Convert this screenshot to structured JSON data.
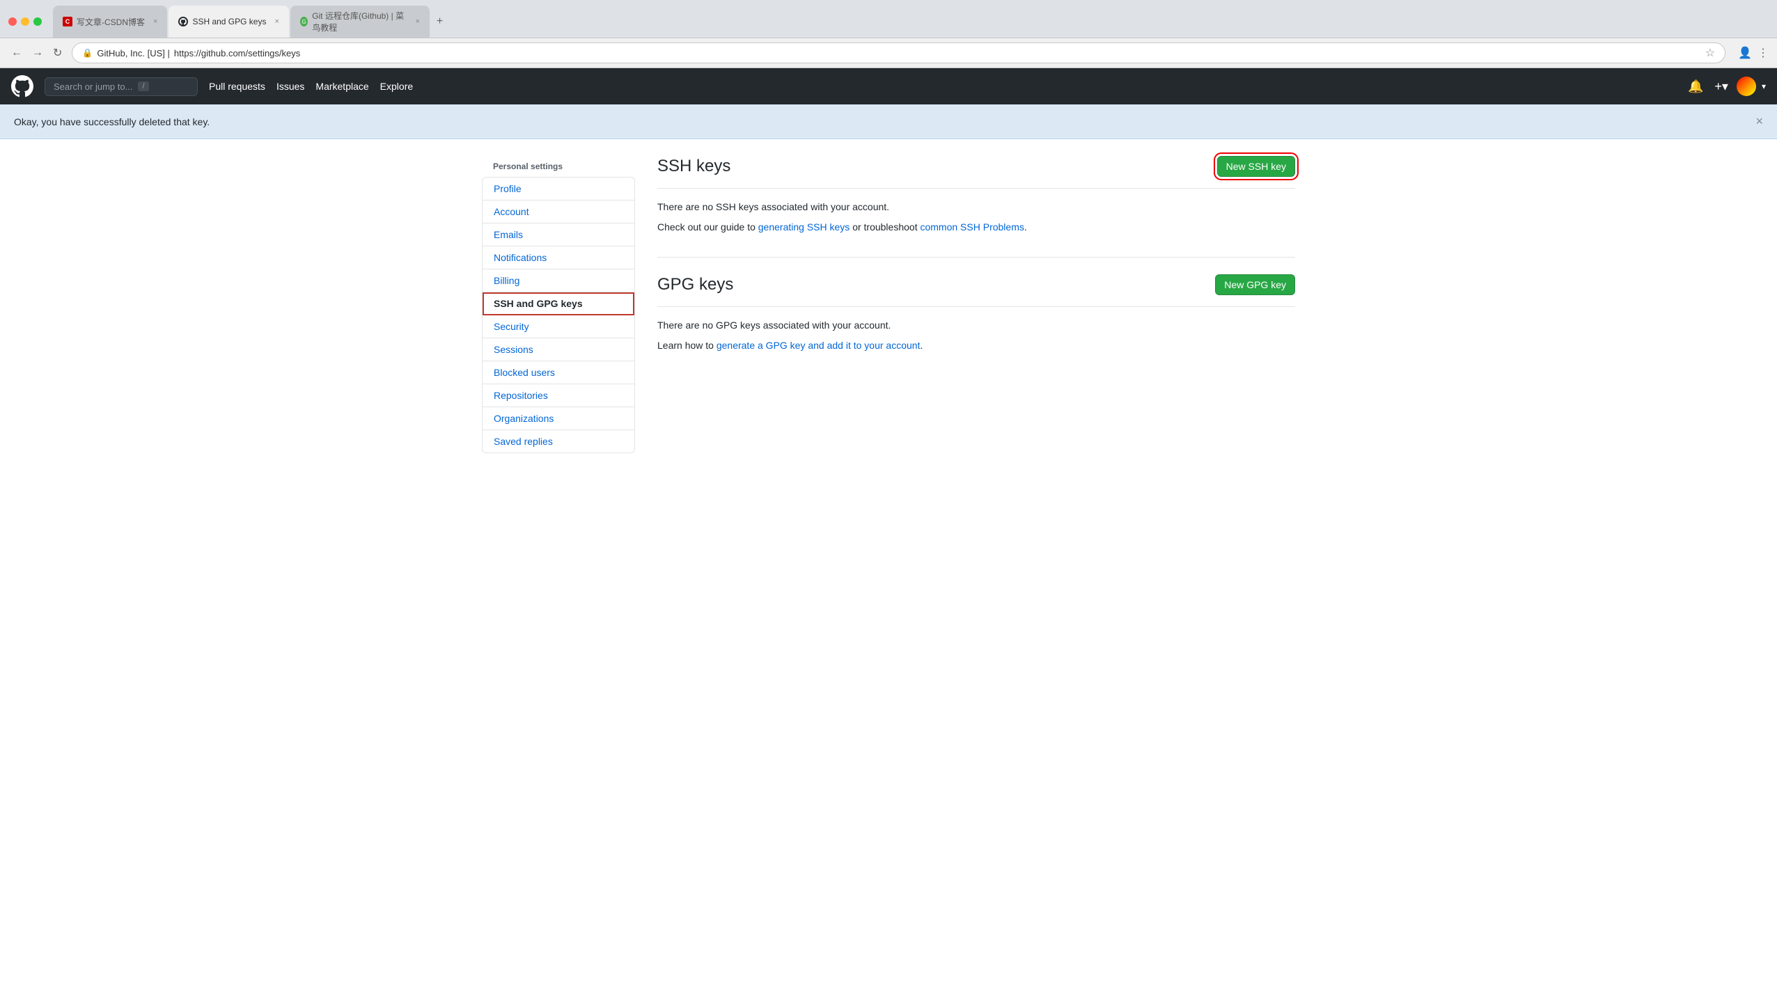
{
  "browser": {
    "tabs": [
      {
        "id": "csdn",
        "label": "写文章-CSDN博客",
        "favicon_type": "csdn",
        "active": false
      },
      {
        "id": "github",
        "label": "SSH and GPG keys",
        "favicon_type": "github",
        "active": true
      },
      {
        "id": "git",
        "label": "Git 远程仓库(Github) | 菜鸟教程",
        "favicon_type": "git",
        "active": false
      }
    ],
    "address": "https://github.com/settings/keys",
    "address_prefix": "GitHub, Inc. [US] | "
  },
  "nav": {
    "search_placeholder": "Search or jump to...",
    "links": [
      "Pull requests",
      "Issues",
      "Marketplace",
      "Explore"
    ]
  },
  "flash": {
    "message": "Okay, you have successfully deleted that key."
  },
  "sidebar": {
    "heading": "Personal settings",
    "items": [
      {
        "id": "profile",
        "label": "Profile",
        "active": false
      },
      {
        "id": "account",
        "label": "Account",
        "active": false
      },
      {
        "id": "emails",
        "label": "Emails",
        "active": false
      },
      {
        "id": "notifications",
        "label": "Notifications",
        "active": false
      },
      {
        "id": "billing",
        "label": "Billing",
        "active": false
      },
      {
        "id": "ssh-gpg",
        "label": "SSH and GPG keys",
        "active": true,
        "highlighted": true
      },
      {
        "id": "security",
        "label": "Security",
        "active": false
      },
      {
        "id": "sessions",
        "label": "Sessions",
        "active": false
      },
      {
        "id": "blocked-users",
        "label": "Blocked users",
        "active": false
      },
      {
        "id": "repositories",
        "label": "Repositories",
        "active": false
      },
      {
        "id": "organizations",
        "label": "Organizations",
        "active": false
      },
      {
        "id": "saved-replies",
        "label": "Saved replies",
        "active": false
      }
    ]
  },
  "main": {
    "ssh_section": {
      "title": "SSH keys",
      "new_button": "New SSH key",
      "empty_message": "There are no SSH keys associated with your account.",
      "guide_text": "Check out our guide to",
      "guide_link1": "generating SSH keys",
      "or_text": "or troubleshoot",
      "guide_link2": "common SSH Problems",
      "guide_link1_url": "#",
      "guide_link2_url": "#"
    },
    "gpg_section": {
      "title": "GPG keys",
      "new_button": "New GPG key",
      "empty_message": "There are no GPG keys associated with your account.",
      "learn_text": "Learn how to",
      "learn_link": "generate a GPG key and add it to your account",
      "learn_link_url": "#"
    }
  }
}
